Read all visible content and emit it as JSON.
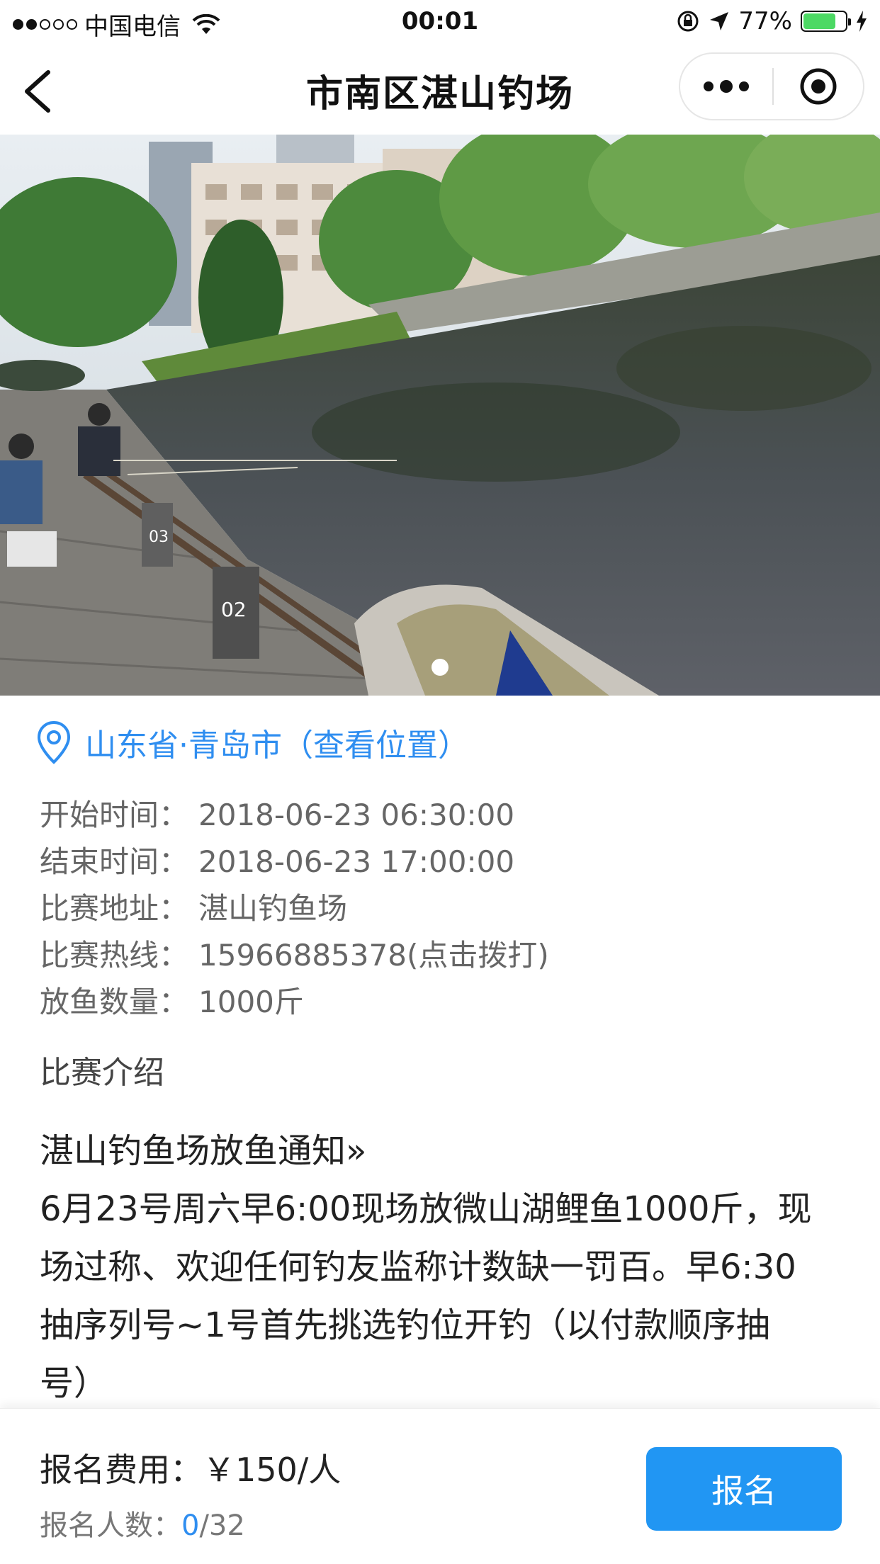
{
  "status_bar": {
    "carrier": "中国电信",
    "time": "00:01",
    "battery": "77%",
    "battery_level": 0.77
  },
  "nav": {
    "title": "市南区湛山钓场"
  },
  "hero": {
    "slide_count": 1,
    "active_slide": 1
  },
  "location": {
    "text": "山东省·青岛市（查看位置）"
  },
  "info": [
    {
      "label": "开始时间：",
      "value": "2018-06-23 06:30:00"
    },
    {
      "label": "结束时间：",
      "value": "2018-06-23 17:00:00"
    },
    {
      "label": "比赛地址：",
      "value": "湛山钓鱼场"
    },
    {
      "label": "比赛热线：",
      "value": "15966885378(点击拨打)"
    },
    {
      "label": "放鱼数量：",
      "value": "1000斤"
    }
  ],
  "section_title": "比赛介绍",
  "description": {
    "heading": "湛山钓鱼场放鱼通知»",
    "lines": [
      "6月23号周六早6:00现场放微山湖鲤鱼1000斤，现",
      "场过称、欢迎任何钓友监称计数缺一罚百。早6:30",
      "抽序列号~1号首先挑选钓位开钓（以付款顺序抽",
      "号）"
    ]
  },
  "bottom": {
    "fee_label": "报名费用：",
    "fee_value": "￥150/人",
    "count_label": "报名人数：",
    "count_current": "0",
    "count_total": "/32",
    "signup_label": "报名"
  },
  "colors": {
    "accent": "#2f8ef0",
    "button": "#2196f3",
    "battery": "#4cd964"
  }
}
